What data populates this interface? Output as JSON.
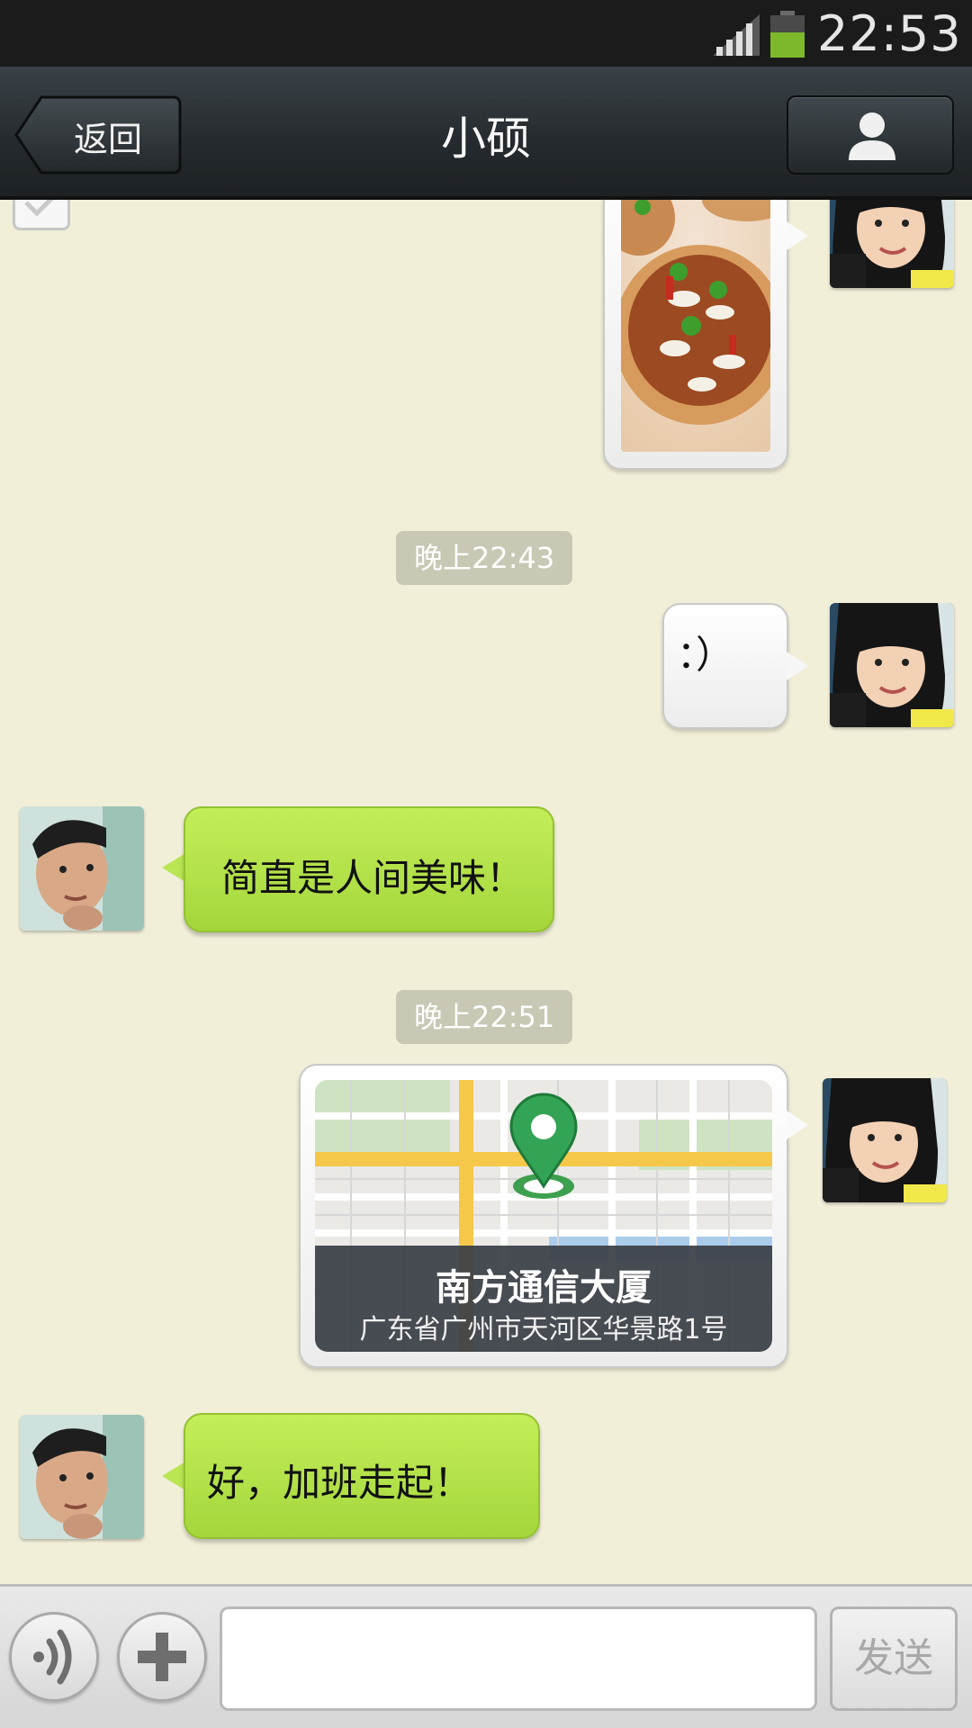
{
  "status_bar": {
    "time": "22:53",
    "battery_color": "#7db82b"
  },
  "header": {
    "back_label": "返回",
    "title": "小硕",
    "profile_icon": "person-icon"
  },
  "messages": [
    {
      "side": "right",
      "type": "image",
      "content": "food-photo"
    },
    {
      "type": "timestamp",
      "text": "晚上22:43"
    },
    {
      "side": "right",
      "type": "text",
      "text": "：）"
    },
    {
      "side": "left",
      "type": "text",
      "text": "简直是人间美味！"
    },
    {
      "type": "timestamp",
      "text": "晚上22:51"
    },
    {
      "side": "right",
      "type": "location",
      "name": "南方通信大厦",
      "address": "广东省广州市天河区华景路1号"
    },
    {
      "side": "left",
      "type": "text",
      "text": "好，加班走起！"
    }
  ],
  "input_bar": {
    "voice_icon": "voice-icon",
    "plus_icon": "plus-icon",
    "input_value": "",
    "send_label": "发送"
  },
  "colors": {
    "chat_bg": "#f2efd9",
    "my_bubble": "#ffffff",
    "friend_bubble": "#b4e14a",
    "timestamp_bg": "#c9c8b5"
  }
}
